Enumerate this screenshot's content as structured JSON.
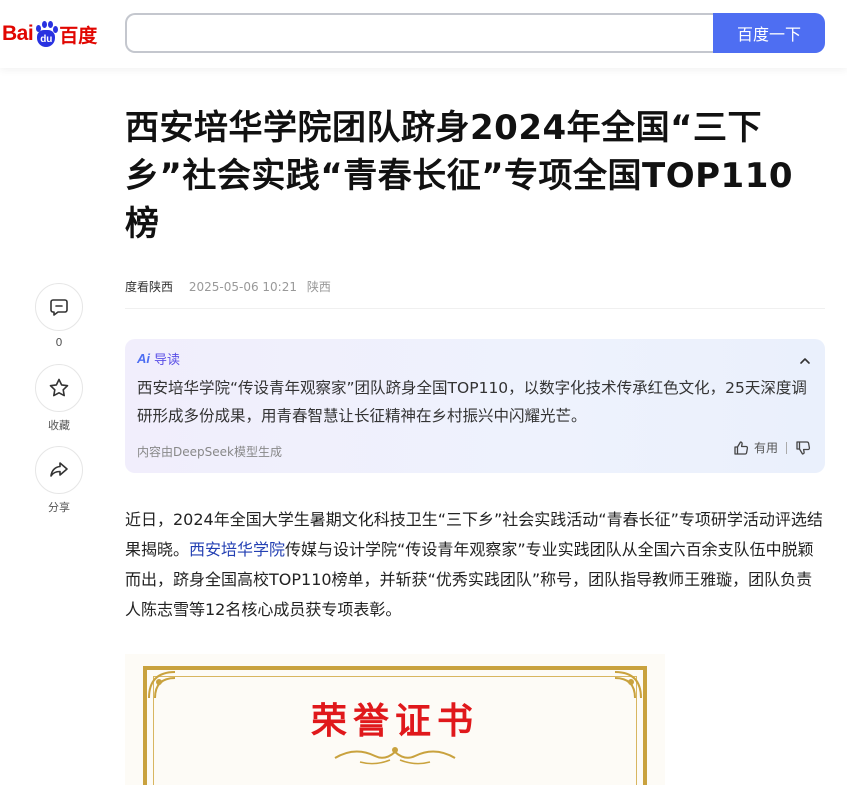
{
  "header": {
    "logo": {
      "bai": "Bai",
      "du": "du",
      "cn": "百度"
    },
    "search": {
      "value": "",
      "placeholder": ""
    },
    "search_button": "百度一下"
  },
  "article": {
    "title": "西安培华学院团队跻身2024年全国“三下乡”社会实践“青春长征”专项全国TOP110榜",
    "author": "度看陕西",
    "time": "2025-05-06 10:21",
    "location": "陕西"
  },
  "side_actions": [
    {
      "label": "0",
      "icon": "comment-icon"
    },
    {
      "label": "收藏",
      "icon": "star-icon"
    },
    {
      "label": "分享",
      "icon": "share-icon"
    }
  ],
  "ai_summary": {
    "badge": "Ai",
    "heading": "导读",
    "text": "西安培华学院“传设青年观察家”团队跻身全国TOP110，以数字化技术传承红色文化，25天深度调研形成多份成果，用青春智慧让长征精神在乡村振兴中闪耀光芒。",
    "footer": "内容由DeepSeek模型生成",
    "useful_label": "有用"
  },
  "body": {
    "p1_before": "近日，2024年全国大学生暑期文化科技卫生“三下乡”社会实践活动“青春长征”专项研学活动评选结果揭晓。",
    "p1_link": "西安培华学院",
    "p1_after": "传媒与设计学院“传设青年观察家”专业实践团队从全国六百余支队伍中脱颖而出，跻身全国高校TOP110榜单，并斩获“优秀实践团队”称号，团队指导教师王雅璇，团队负责人陈志雪等12名核心成员获专项表彰。"
  },
  "certificate": {
    "title": "荣誉证书"
  },
  "colors": {
    "brand_blue": "#4e6ef2",
    "baidu_red": "#e10601",
    "link_blue": "#2440b3",
    "cert_gold": "#c9a23e",
    "cert_red": "#e0181b"
  }
}
